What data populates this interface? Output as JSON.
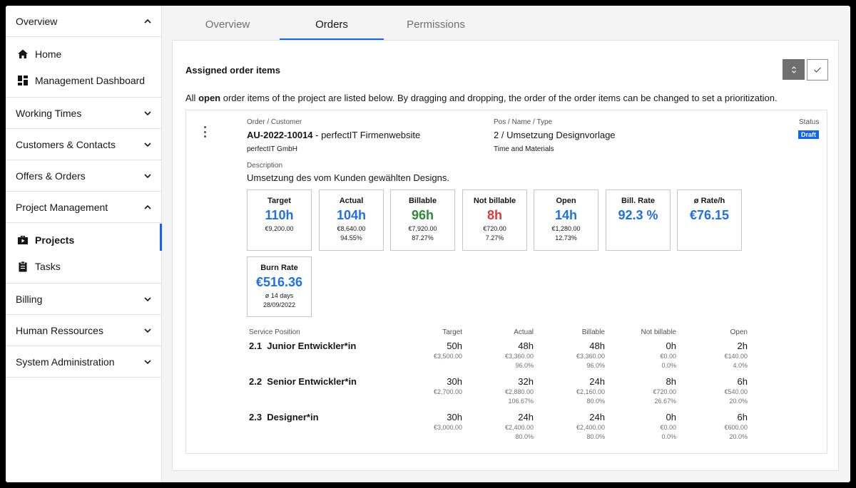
{
  "sidebar": {
    "overview": "Overview",
    "home": "Home",
    "dashboard": "Management Dashboard",
    "working_times": "Working Times",
    "customers": "Customers & Contacts",
    "offers": "Offers & Orders",
    "project_management": "Project Management",
    "projects": "Projects",
    "tasks": "Tasks",
    "billing": "Billing",
    "human_resources": "Human Ressources",
    "system_admin": "System Administration"
  },
  "tabs": [
    "Overview",
    "Orders",
    "Permissions"
  ],
  "panel": {
    "title": "Assigned order items",
    "intro_pre": "All ",
    "intro_bold": "open",
    "intro_post": " order items of the project are listed below. By dragging and dropping, the order of the order items can be changed to set a prioritization."
  },
  "item": {
    "order_label": "Order / Customer",
    "order_number": "AU-2022-10014",
    "order_name": " - perfectIT Firmenwebsite",
    "customer": "perfectIT GmbH",
    "pos_label": "Pos / Name / Type",
    "pos_value": "2 / Umsetzung Designvorlage",
    "pos_type": "Time and Materials",
    "status_label": "Status",
    "status": "Draft",
    "desc_label": "Description",
    "description": "Umsetzung des vom Kunden gewählten Designs."
  },
  "kpis": [
    {
      "title": "Target",
      "value": "110h",
      "sub1": "€9,200.00",
      "sub2": ""
    },
    {
      "title": "Actual",
      "value": "104h",
      "sub1": "€8,640.00",
      "sub2": "94.55%"
    },
    {
      "title": "Billable",
      "value": "96h",
      "sub1": "€7,920.00",
      "sub2": "87.27%"
    },
    {
      "title": "Not billable",
      "value": "8h",
      "sub1": "€720.00",
      "sub2": "7.27%"
    },
    {
      "title": "Open",
      "value": "14h",
      "sub1": "€1,280.00",
      "sub2": "12.73%"
    },
    {
      "title": "Bill. Rate",
      "value": "92.3 %",
      "sub1": "",
      "sub2": ""
    },
    {
      "title": "ø Rate/h",
      "value": "€76.15",
      "sub1": "",
      "sub2": ""
    },
    {
      "title": "Burn Rate",
      "value": "€516.36",
      "sub1": "ø 14 days",
      "sub2": "28/09/2022"
    }
  ],
  "colors": {
    "accent": "#0f62fe",
    "blue_value": "#1f6feb",
    "green_value": "#2e8b3a",
    "red_value": "#d93a3a"
  },
  "positions": {
    "headers": [
      "Service Position",
      "Target",
      "Actual",
      "Billable",
      "Not billable",
      "Open"
    ],
    "rows": [
      {
        "name": "2.1  Junior Entwickler*in",
        "cells": [
          [
            "50h",
            "€3,500.00",
            ""
          ],
          [
            "48h",
            "€3,360.00",
            "96.0%"
          ],
          [
            "48h",
            "€3,360.00",
            "96.0%"
          ],
          [
            "0h",
            "€0.00",
            "0.0%"
          ],
          [
            "2h",
            "€140.00",
            "4.0%"
          ]
        ]
      },
      {
        "name": "2.2  Senior Entwickler*in",
        "cells": [
          [
            "30h",
            "€2,700.00",
            ""
          ],
          [
            "32h",
            "€2,880.00",
            "106.67%"
          ],
          [
            "24h",
            "€2,160.00",
            "80.0%"
          ],
          [
            "8h",
            "€720.00",
            "26.67%"
          ],
          [
            "6h",
            "€540.00",
            "20.0%"
          ]
        ]
      },
      {
        "name": "2.3  Designer*in",
        "cells": [
          [
            "30h",
            "€3,000.00",
            ""
          ],
          [
            "24h",
            "€2,400.00",
            "80.0%"
          ],
          [
            "24h",
            "€2,400.00",
            "80.0%"
          ],
          [
            "0h",
            "€0.00",
            "0.0%"
          ],
          [
            "6h",
            "€600.00",
            "20.0%"
          ]
        ]
      }
    ]
  }
}
